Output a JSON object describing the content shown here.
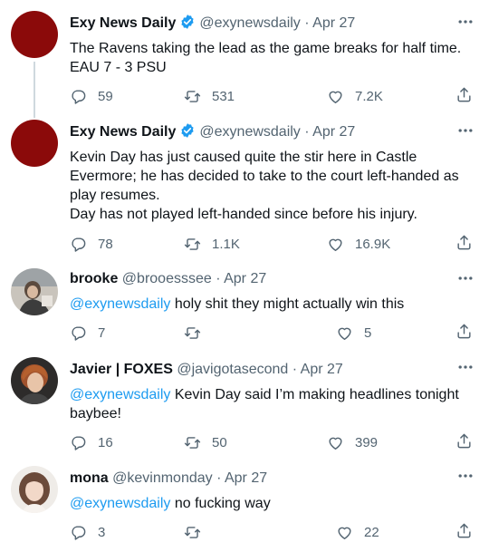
{
  "tweets": [
    {
      "name": "Exy News Daily",
      "verified": true,
      "handle": "@exynewsdaily",
      "date": "Apr 27",
      "mention": "",
      "text": "The Ravens taking the lead as the game breaks for half time.\nEAU 7 - 3 PSU",
      "replies": "59",
      "retweets": "531",
      "likes": "7.2K"
    },
    {
      "name": "Exy News Daily",
      "verified": true,
      "handle": "@exynewsdaily",
      "date": "Apr 27",
      "mention": "",
      "text": "Kevin Day has just caused quite the stir here in Castle Evermore; he has decided to take to the court left-handed as play resumes.\nDay has not played left-handed since before his injury.",
      "replies": "78",
      "retweets": "1.1K",
      "likes": "16.9K"
    },
    {
      "name": "brooke",
      "verified": false,
      "handle": "@brooesssee",
      "date": "Apr 27",
      "mention": "@exynewsdaily",
      "text": " holy shit they might actually win this",
      "replies": "7",
      "retweets": "",
      "likes": "5"
    },
    {
      "name": "Javier | FOXES",
      "verified": false,
      "handle": "@javigotasecond",
      "date": "Apr 27",
      "mention": "@exynewsdaily",
      "text": " Kevin Day said I’m making headlines tonight baybee!",
      "replies": "16",
      "retweets": "50",
      "likes": "399"
    },
    {
      "name": "mona",
      "verified": false,
      "handle": "@kevinmonday",
      "date": "Apr 27",
      "mention": "@exynewsdaily",
      "text": " no fucking way",
      "replies": "3",
      "retweets": "",
      "likes": "22"
    }
  ],
  "separator": "·",
  "colors": {
    "accent": "#1d9bf0",
    "muted": "#536471",
    "text": "#0f1419",
    "avatar_red": "#8b0a0a",
    "thread_line": "#cfd9de"
  },
  "icons": {
    "reply": "reply-icon",
    "retweet": "retweet-icon",
    "like": "heart-icon",
    "share": "share-icon",
    "more": "more-icon",
    "verified": "verified-badge-icon"
  }
}
